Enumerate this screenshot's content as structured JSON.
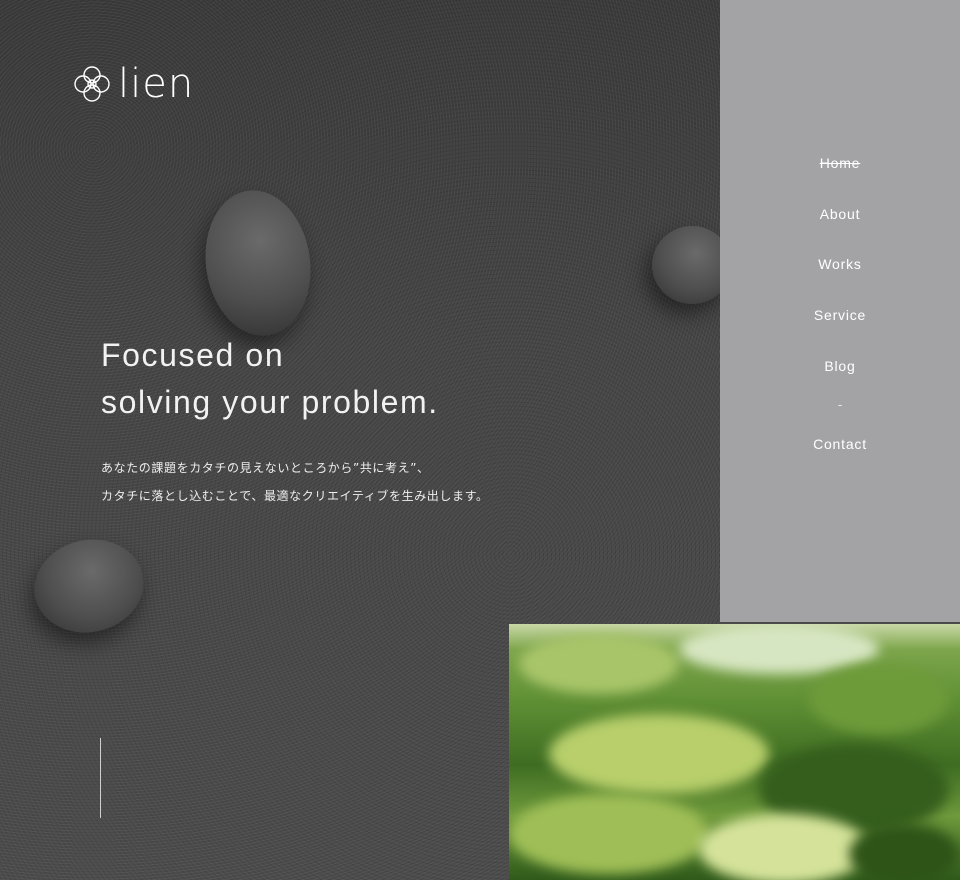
{
  "brand": {
    "name": "lien"
  },
  "hero": {
    "headline": [
      "Focused on",
      "solving your problem."
    ],
    "lead": [
      "あなたの課題をカタチの見えないところから”共に考え”、",
      "カタチに落とし込むことで、最適なクリエイティブを生み出します。"
    ]
  },
  "nav": {
    "items": [
      {
        "label": "Home",
        "current": true
      },
      {
        "label": "About"
      },
      {
        "label": "Works"
      },
      {
        "label": "Service"
      },
      {
        "label": "Blog"
      }
    ],
    "separator": "-",
    "contact": "Contact"
  },
  "colors": {
    "hero_bg": "#4a4a4a",
    "nav_bg": "#a3a3a5",
    "text": "#ffffff"
  },
  "icons": {
    "logo": "knot-icon"
  }
}
